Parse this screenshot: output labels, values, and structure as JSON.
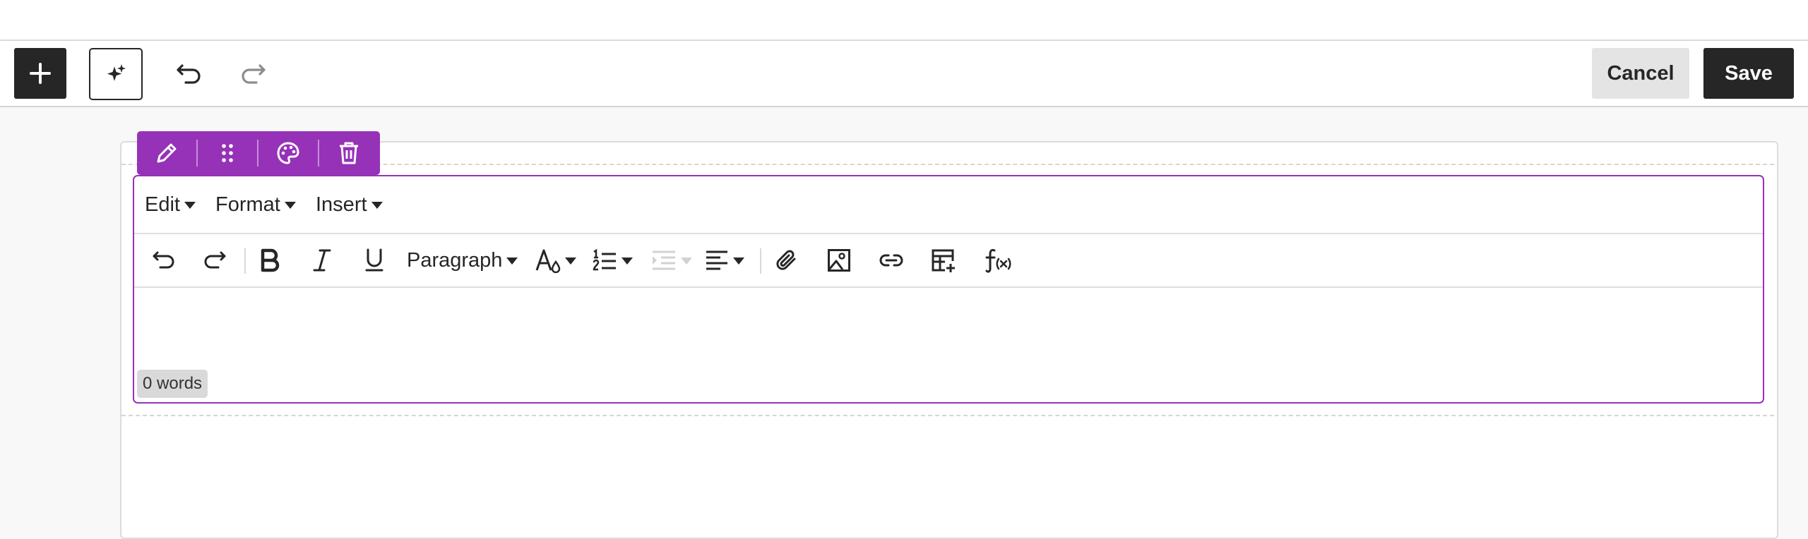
{
  "toolbar": {
    "cancel_label": "Cancel",
    "save_label": "Save"
  },
  "editor": {
    "menus": [
      {
        "label": "Edit"
      },
      {
        "label": "Format"
      },
      {
        "label": "Insert"
      }
    ],
    "block_style_label": "Paragraph",
    "word_count": "0 words"
  },
  "icons": {
    "top_toolbar": [
      "plus-icon",
      "sparkle-icon",
      "undo-icon",
      "redo-icon"
    ],
    "block_toolbar": [
      "pencil-icon",
      "drag-handle-icon",
      "palette-icon",
      "trash-icon"
    ],
    "format_toolbar": [
      "undo-icon",
      "redo-icon",
      "bold-icon",
      "italic-icon",
      "underline-icon",
      "text-color-icon",
      "numbered-list-icon",
      "indent-icon",
      "align-left-icon",
      "attachment-icon",
      "image-icon",
      "link-icon",
      "table-icon",
      "formula-icon"
    ]
  },
  "colors": {
    "accent_purple": "#9632b8",
    "dark_button": "#262626",
    "cancel_button": "#e4e4e4",
    "disabled_icon": "#d2d2d2"
  }
}
